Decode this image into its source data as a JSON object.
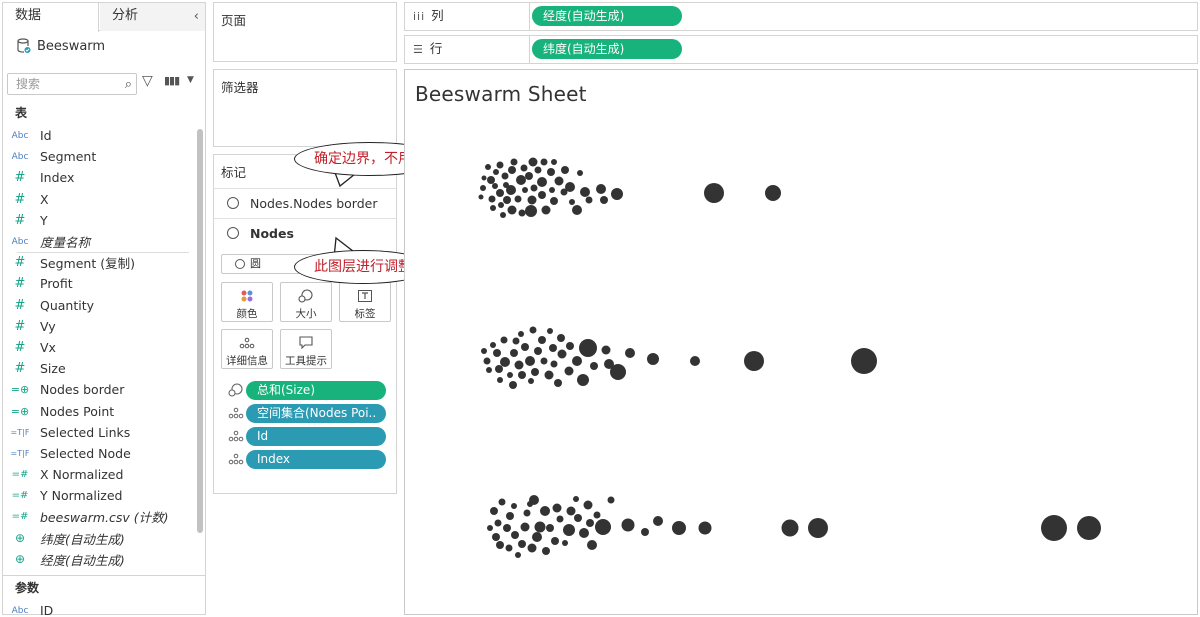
{
  "left_pane": {
    "tabs": {
      "data": "数据",
      "analytics": "分析",
      "collapse": "‹"
    },
    "datasource": "Beeswarm",
    "search_placeholder": "搜索",
    "tables_heading": "表",
    "params_heading": "参数",
    "fields": [
      {
        "type": "Abc",
        "label": "Id",
        "italic": false
      },
      {
        "type": "Abc",
        "label": "Segment",
        "italic": false
      },
      {
        "type": "#",
        "label": "Index",
        "italic": false
      },
      {
        "type": "#",
        "label": "X",
        "italic": false
      },
      {
        "type": "#",
        "label": "Y",
        "italic": false
      },
      {
        "type": "Abc",
        "label": "度量名称",
        "italic": true
      },
      {
        "type": "#",
        "label": "Segment (复制)",
        "italic": false
      },
      {
        "type": "#",
        "label": "Profit",
        "italic": false
      },
      {
        "type": "#",
        "label": "Quantity",
        "italic": false
      },
      {
        "type": "#",
        "label": "Vy",
        "italic": false
      },
      {
        "type": "#",
        "label": "Vx",
        "italic": false
      },
      {
        "type": "#",
        "label": "Size",
        "italic": false
      },
      {
        "type": "=geo",
        "label": "Nodes border",
        "italic": false
      },
      {
        "type": "=geo",
        "label": "Nodes Point",
        "italic": false
      },
      {
        "type": "=T|F",
        "label": "Selected Links",
        "italic": false
      },
      {
        "type": "=T|F",
        "label": "Selected Node",
        "italic": false
      },
      {
        "type": "=#",
        "label": "X Normalized",
        "italic": false
      },
      {
        "type": "=#",
        "label": "Y Normalized",
        "italic": false
      },
      {
        "type": "=#",
        "label": "beeswarm.csv (计数)",
        "italic": true
      },
      {
        "type": "geo",
        "label": "纬度(自动生成)",
        "italic": true
      },
      {
        "type": "geo",
        "label": "经度(自动生成)",
        "italic": true
      }
    ],
    "params": [
      {
        "type": "Abc",
        "label": "ID"
      }
    ]
  },
  "pages": {
    "title": "页面"
  },
  "filters": {
    "title": "筛选器"
  },
  "marks": {
    "title": "标记",
    "layers": [
      {
        "label": "Nodes.Nodes border",
        "bold": false
      },
      {
        "label": "Nodes",
        "bold": true
      }
    ],
    "mark_type": "圆",
    "buttons": {
      "color": "颜色",
      "size": "大小",
      "label": "标签",
      "detail": "详细信息",
      "tooltip": "工具提示"
    },
    "pills": [
      {
        "label": "总和(Size)",
        "color": "green",
        "icon": "size-icon"
      },
      {
        "label": "空间集合(Nodes Poi..",
        "color": "blue",
        "icon": "detail-icon"
      },
      {
        "label": "Id",
        "color": "blue",
        "icon": "detail-icon"
      },
      {
        "label": "Index",
        "color": "blue",
        "icon": "detail-icon"
      }
    ]
  },
  "callouts": {
    "top": "确定边界，不用管",
    "bottom": "此图层进行调整"
  },
  "shelves": {
    "columns": {
      "label": "列",
      "pill": "经度(自动生成)"
    },
    "rows": {
      "label": "行",
      "pill": "纬度(自动生成)"
    }
  },
  "view": {
    "sheet_title": "Beeswarm Sheet"
  },
  "chart_data": {
    "type": "scatter",
    "title": "Beeswarm Sheet",
    "mark_color": "#333333",
    "series": [
      {
        "name": "",
        "points": [
          [
            481,
            197,
            2.5
          ],
          [
            483,
            188,
            3
          ],
          [
            484,
            178,
            2.5
          ],
          [
            488,
            167,
            3
          ],
          [
            491,
            180,
            4
          ],
          [
            492,
            199,
            3.5
          ],
          [
            493,
            208,
            3
          ],
          [
            495,
            186,
            3
          ],
          [
            496,
            172,
            3
          ],
          [
            500,
            165,
            3.5
          ],
          [
            500,
            193,
            4
          ],
          [
            501,
            205,
            3
          ],
          [
            503,
            215,
            3
          ],
          [
            505,
            176,
            3.5
          ],
          [
            506,
            185,
            3
          ],
          [
            507,
            200,
            4
          ],
          [
            511,
            190,
            5
          ],
          [
            512,
            170,
            4
          ],
          [
            512,
            210,
            4.5
          ],
          [
            514,
            162,
            3.5
          ],
          [
            518,
            199,
            3.5
          ],
          [
            521,
            180,
            5
          ],
          [
            522,
            213,
            3.5
          ],
          [
            524,
            168,
            3.5
          ],
          [
            525,
            190,
            3
          ],
          [
            529,
            176,
            4
          ],
          [
            531,
            211,
            6
          ],
          [
            532,
            200,
            4.5
          ],
          [
            533,
            162,
            4.5
          ],
          [
            534,
            188,
            3.5
          ],
          [
            538,
            170,
            3.5
          ],
          [
            542,
            182,
            5
          ],
          [
            542,
            195,
            4
          ],
          [
            544,
            162,
            3.5
          ],
          [
            546,
            210,
            4.5
          ],
          [
            551,
            172,
            4
          ],
          [
            552,
            190,
            3
          ],
          [
            554,
            162,
            3
          ],
          [
            554,
            201,
            4
          ],
          [
            559,
            181,
            4.5
          ],
          [
            564,
            192,
            3.5
          ],
          [
            565,
            170,
            4
          ],
          [
            570,
            187,
            5
          ],
          [
            572,
            202,
            3
          ],
          [
            577,
            210,
            5
          ],
          [
            580,
            173,
            3
          ],
          [
            585,
            192,
            5
          ],
          [
            589,
            200,
            3.5
          ],
          [
            601,
            189,
            5
          ],
          [
            604,
            200,
            4
          ],
          [
            617,
            194,
            6
          ],
          [
            714,
            193,
            10
          ],
          [
            773,
            193,
            8
          ]
        ]
      },
      {
        "name": "",
        "points": [
          [
            484,
            351,
            3
          ],
          [
            487,
            361,
            3.5
          ],
          [
            489,
            370,
            3
          ],
          [
            493,
            345,
            3
          ],
          [
            497,
            353,
            4
          ],
          [
            499,
            369,
            4
          ],
          [
            500,
            380,
            3
          ],
          [
            504,
            340,
            3.5
          ],
          [
            505,
            362,
            5
          ],
          [
            510,
            375,
            3
          ],
          [
            513,
            385,
            4
          ],
          [
            514,
            353,
            4
          ],
          [
            516,
            341,
            3.5
          ],
          [
            519,
            365,
            4.5
          ],
          [
            521,
            334,
            3
          ],
          [
            522,
            375,
            4
          ],
          [
            525,
            347,
            4
          ],
          [
            530,
            361,
            5
          ],
          [
            531,
            381,
            3
          ],
          [
            533,
            330,
            3.5
          ],
          [
            535,
            372,
            4
          ],
          [
            538,
            351,
            4
          ],
          [
            542,
            340,
            4
          ],
          [
            544,
            361,
            3.5
          ],
          [
            549,
            375,
            4.5
          ],
          [
            550,
            331,
            3
          ],
          [
            553,
            348,
            4
          ],
          [
            554,
            364,
            3.5
          ],
          [
            558,
            383,
            4
          ],
          [
            561,
            338,
            4
          ],
          [
            562,
            354,
            4.5
          ],
          [
            569,
            371,
            4.5
          ],
          [
            570,
            346,
            4
          ],
          [
            577,
            361,
            5
          ],
          [
            583,
            380,
            6
          ],
          [
            588,
            348,
            9
          ],
          [
            594,
            366,
            4
          ],
          [
            606,
            350,
            4.5
          ],
          [
            609,
            364,
            5
          ],
          [
            618,
            372,
            8
          ],
          [
            630,
            353,
            5
          ],
          [
            653,
            359,
            6
          ],
          [
            695,
            361,
            5
          ],
          [
            754,
            361,
            10
          ],
          [
            864,
            361,
            13
          ]
        ]
      },
      {
        "name": "",
        "points": [
          [
            490,
            528,
            3
          ],
          [
            494,
            511,
            4
          ],
          [
            496,
            537,
            4
          ],
          [
            498,
            523,
            3.5
          ],
          [
            500,
            545,
            4
          ],
          [
            502,
            502,
            3.5
          ],
          [
            507,
            528,
            4
          ],
          [
            509,
            548,
            3.5
          ],
          [
            510,
            516,
            4
          ],
          [
            514,
            506,
            3
          ],
          [
            515,
            535,
            4
          ],
          [
            518,
            555,
            3
          ],
          [
            522,
            544,
            4
          ],
          [
            525,
            527,
            4.5
          ],
          [
            527,
            513,
            3.5
          ],
          [
            530,
            504,
            3
          ],
          [
            532,
            548,
            4.5
          ],
          [
            534,
            500,
            5
          ],
          [
            537,
            537,
            5
          ],
          [
            540,
            527,
            5.5
          ],
          [
            545,
            511,
            5
          ],
          [
            546,
            551,
            4
          ],
          [
            550,
            528,
            4
          ],
          [
            555,
            541,
            4
          ],
          [
            557,
            508,
            4.5
          ],
          [
            560,
            519,
            3.5
          ],
          [
            565,
            543,
            3
          ],
          [
            569,
            530,
            6
          ],
          [
            571,
            511,
            4.5
          ],
          [
            576,
            499,
            3
          ],
          [
            578,
            518,
            4
          ],
          [
            584,
            533,
            5
          ],
          [
            588,
            505,
            4.5
          ],
          [
            590,
            523,
            4
          ],
          [
            592,
            545,
            5
          ],
          [
            597,
            515,
            3.5
          ],
          [
            603,
            527,
            8
          ],
          [
            611,
            500,
            3.5
          ],
          [
            628,
            525,
            6.5
          ],
          [
            645,
            532,
            4
          ],
          [
            658,
            521,
            5
          ],
          [
            679,
            528,
            7
          ],
          [
            705,
            528,
            6.5
          ],
          [
            790,
            528,
            8.5
          ],
          [
            818,
            528,
            10
          ],
          [
            1054,
            528,
            13
          ],
          [
            1089,
            528,
            12
          ]
        ]
      }
    ]
  }
}
